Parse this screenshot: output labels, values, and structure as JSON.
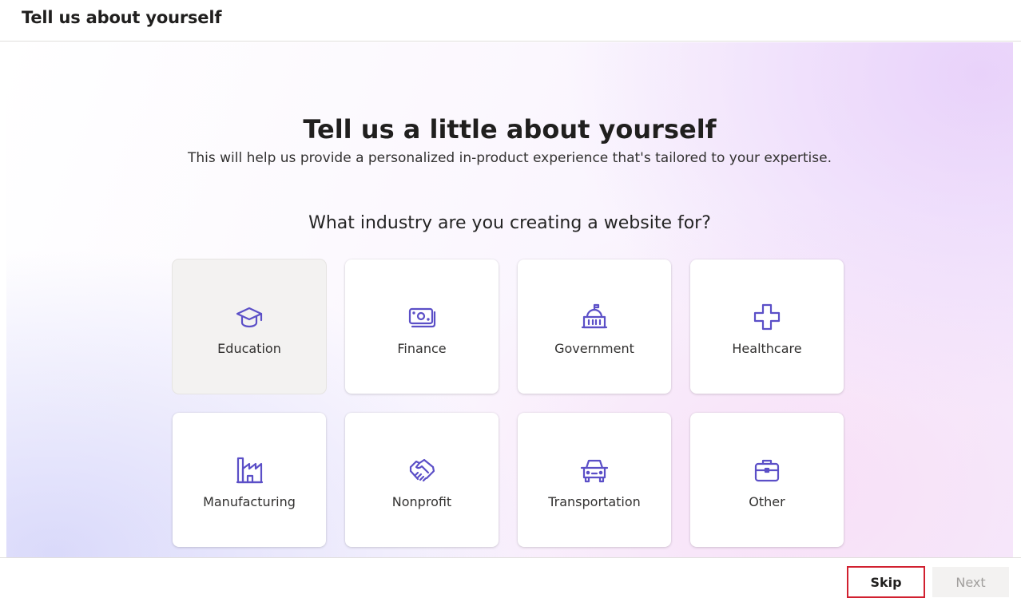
{
  "header": {
    "title": "Tell us about yourself"
  },
  "main": {
    "heading": "Tell us a little about yourself",
    "subheading": "This will help us provide a personalized in-product experience that's tailored to your expertise.",
    "question": "What industry are you creating a website for?",
    "industries": [
      {
        "label": "Education",
        "icon": "graduation-cap-icon",
        "selected": true
      },
      {
        "label": "Finance",
        "icon": "money-icon",
        "selected": false
      },
      {
        "label": "Government",
        "icon": "government-building-icon",
        "selected": false
      },
      {
        "label": "Healthcare",
        "icon": "medical-cross-icon",
        "selected": false
      },
      {
        "label": "Manufacturing",
        "icon": "factory-icon",
        "selected": false
      },
      {
        "label": "Nonprofit",
        "icon": "handshake-icon",
        "selected": false
      },
      {
        "label": "Transportation",
        "icon": "car-icon",
        "selected": false
      },
      {
        "label": "Other",
        "icon": "briefcase-icon",
        "selected": false
      }
    ]
  },
  "footer": {
    "skip_label": "Skip",
    "next_label": "Next"
  },
  "colors": {
    "icon": "#5b4fc7",
    "skip_border": "#d1202f",
    "selected_card": "#f3f2f1"
  }
}
